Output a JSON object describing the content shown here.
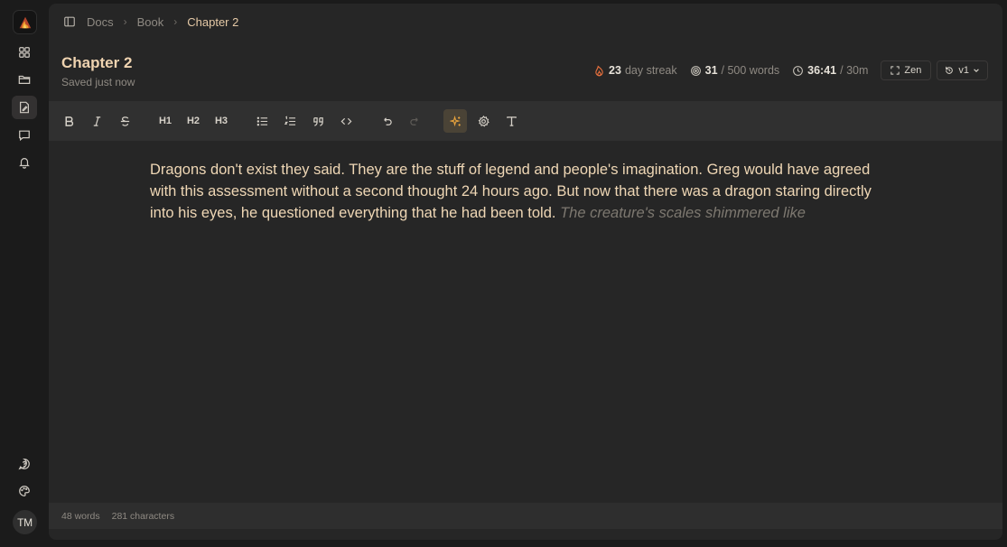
{
  "breadcrumb": {
    "items": [
      "Docs",
      "Book",
      "Chapter 2"
    ]
  },
  "document": {
    "title": "Chapter 2",
    "save_status": "Saved just now"
  },
  "stats": {
    "streak_value": "23",
    "streak_label": "day streak",
    "words_value": "31",
    "words_goal": "/ 500 words",
    "time_value": "36:41",
    "time_goal": "/ 30m",
    "zen_label": "Zen",
    "version_label": "v1"
  },
  "toolbar": {
    "h1": "H1",
    "h2": "H2",
    "h3": "H3",
    "icons": [
      "bold-icon",
      "italic-icon",
      "strikethrough-icon",
      "heading-1",
      "heading-2",
      "heading-3",
      "bullet-list-icon",
      "numbered-list-icon",
      "quote-icon",
      "code-icon",
      "undo-icon",
      "redo-icon",
      "ai-sparkle-icon",
      "settings-icon",
      "text-format-icon"
    ]
  },
  "editor": {
    "text": "Dragons don't exist they said. They are the stuff of legend and people's imagination. Greg would have agreed with this assessment without a second thought 24 hours ago. But now that there was a dragon staring directly into his eyes, he questioned everything that he had been told.",
    "suggestion": "The creature's scales shimmered like"
  },
  "footer": {
    "words": "48 words",
    "characters": "281 characters"
  },
  "user": {
    "initials": "TM"
  },
  "colors": {
    "accent": "#e8a33d",
    "title": "#efd3b0",
    "panel": "#262626",
    "toolbar": "#303030"
  }
}
